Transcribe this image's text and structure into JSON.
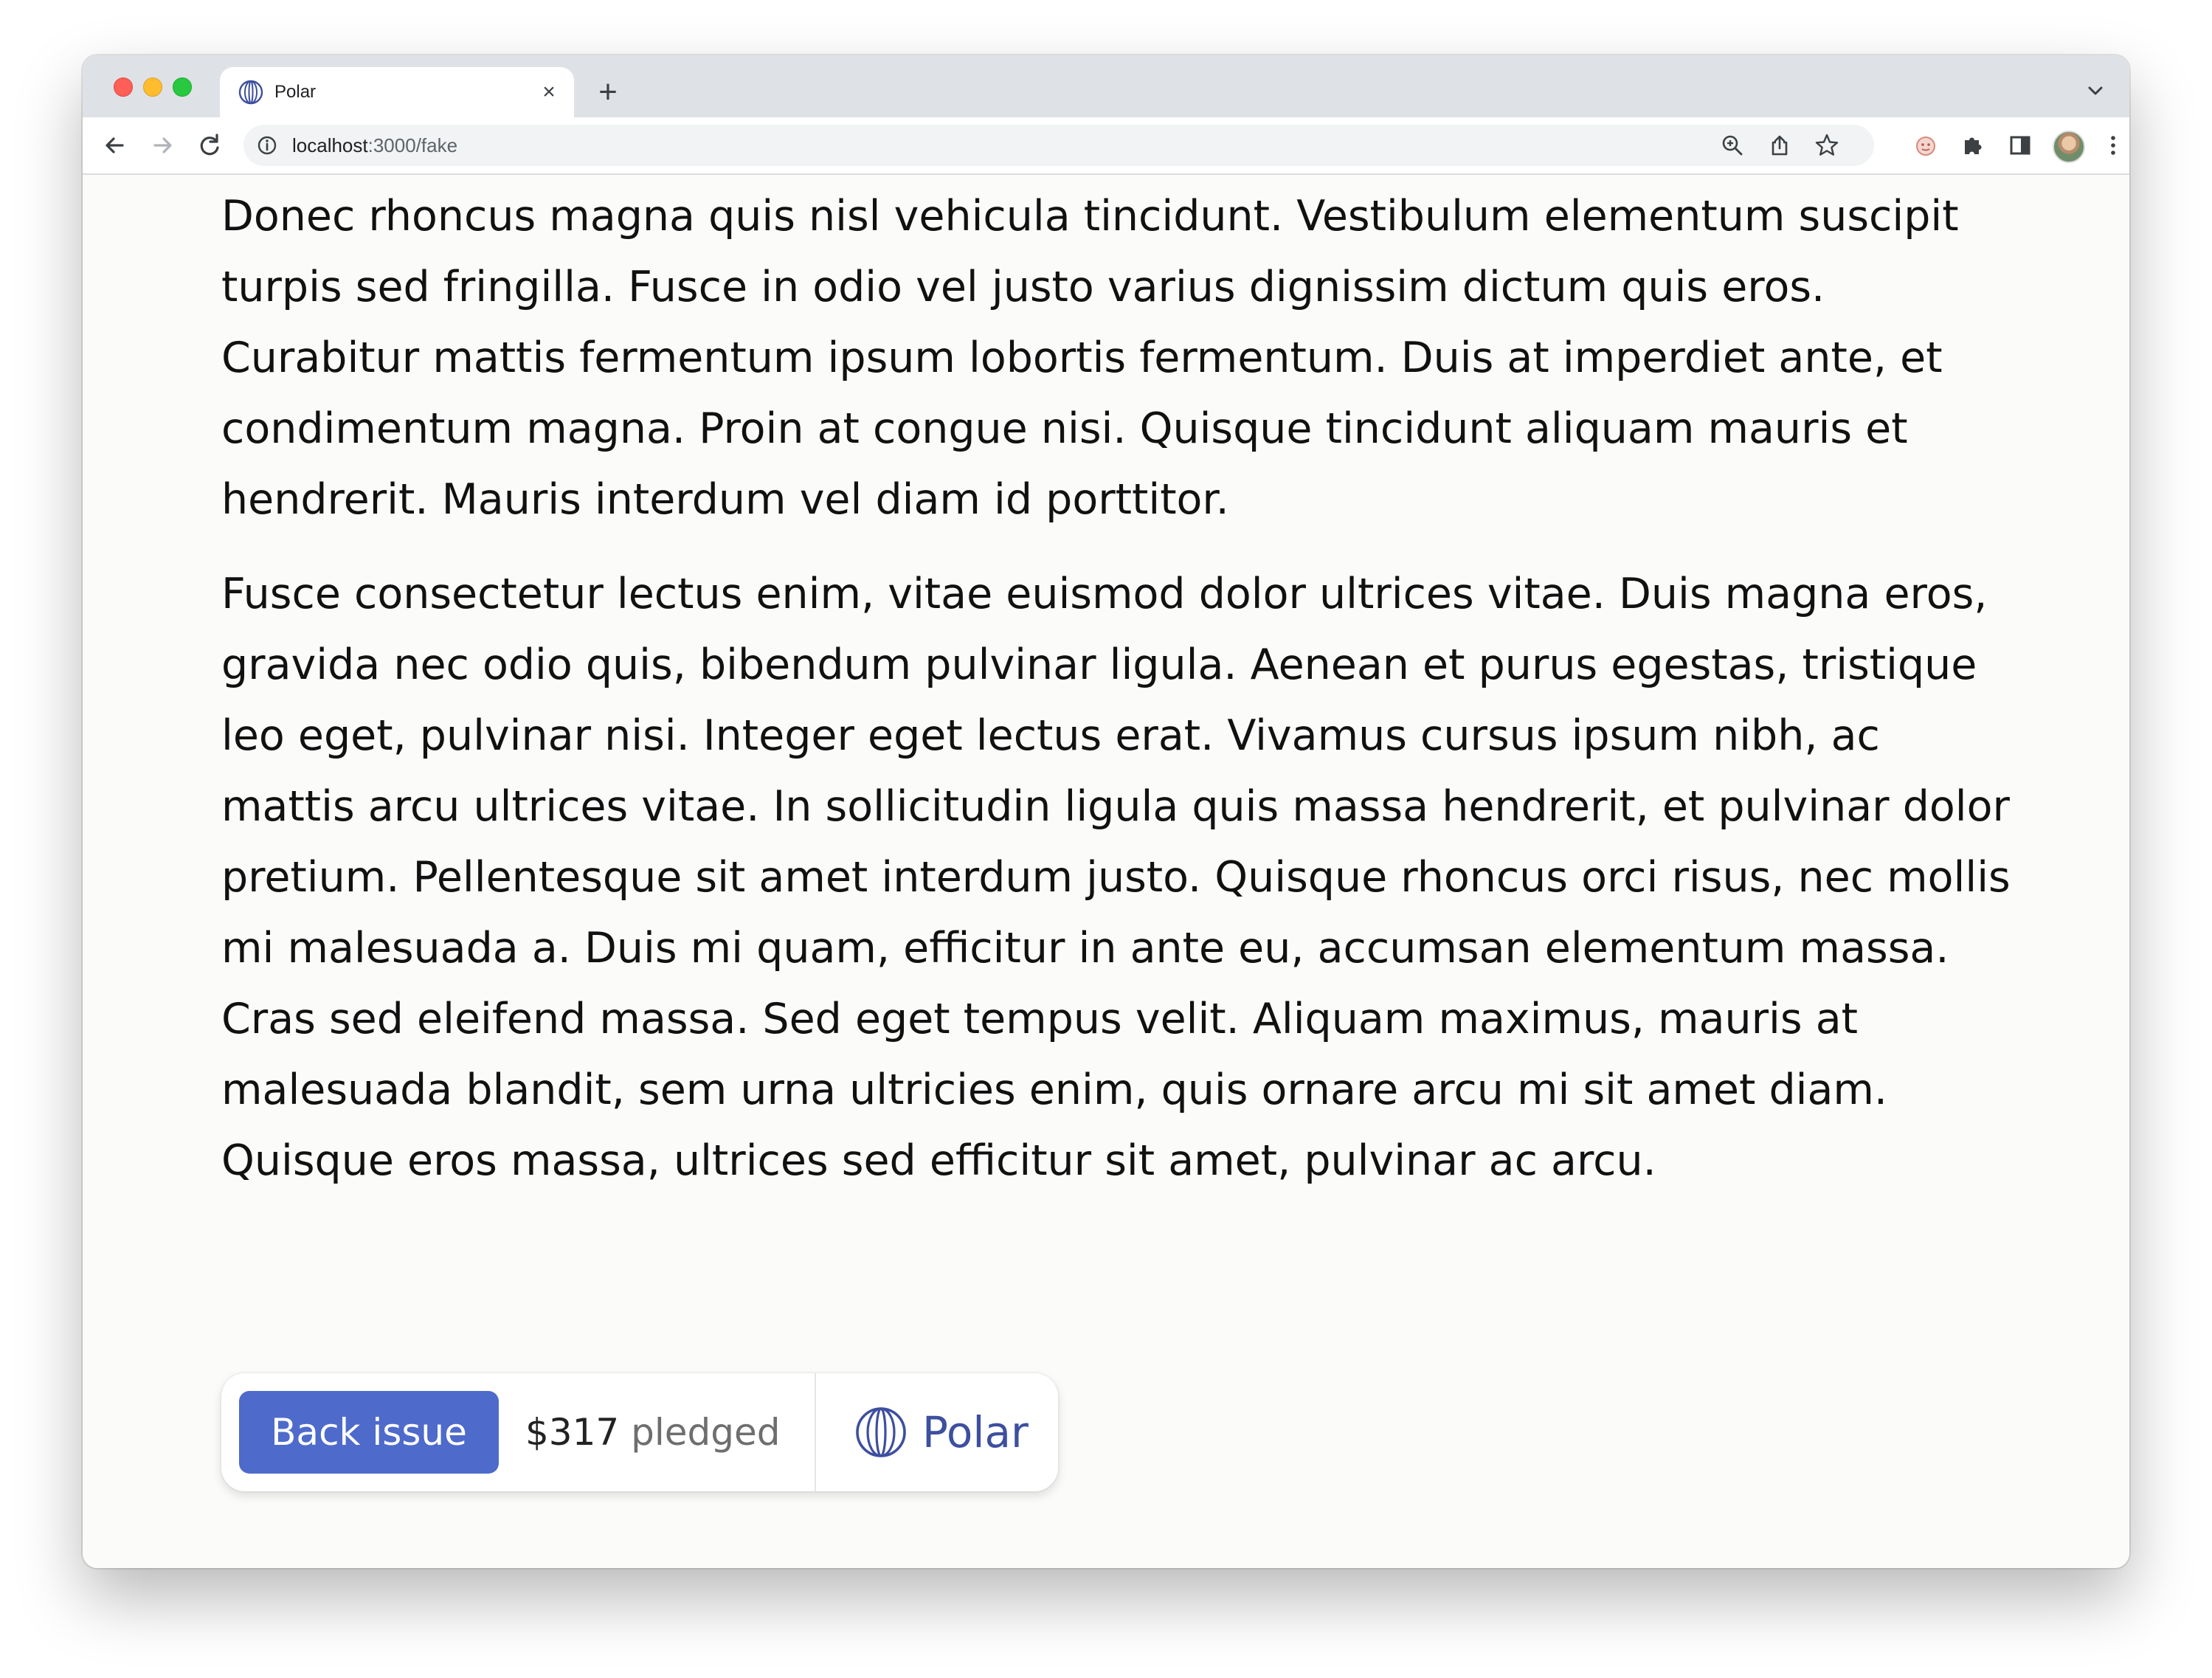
{
  "browser": {
    "tab": {
      "title": "Polar",
      "favicon": "polar-logo-icon",
      "close_glyph": "×"
    },
    "new_tab_glyph": "+",
    "url_host": "localhost",
    "url_path": ":3000/fake",
    "icons": {
      "back": "arrow-left-icon",
      "forward": "arrow-right-icon",
      "reload": "reload-icon",
      "site_info": "info-icon",
      "zoom": "zoom-icon",
      "share": "share-icon",
      "bookmark": "star-icon",
      "extension": "extension-icon",
      "puzzle": "puzzle-icon",
      "side_panel": "side-panel-icon",
      "menu": "kebab-menu-icon"
    }
  },
  "article": {
    "paragraphs": [
      "sit amet tempor non, sodales vel metus. Nullam volutpat dictum orci at maximus. Donec rhoncus magna quis nisl vehicula tincidunt. Vestibulum elementum suscipit turpis sed fringilla. Fusce in odio vel justo varius dignissim dictum quis eros. Curabitur mattis fermentum ipsum lobortis fermentum. Duis at imperdiet ante, et condimentum magna. Proin at congue nisi. Quisque tincidunt aliquam mauris et hendrerit. Mauris interdum vel diam id porttitor.",
      "Fusce consectetur lectus enim, vitae euismod dolor ultrices vitae. Duis magna eros, gravida nec odio quis, bibendum pulvinar ligula. Aenean et purus egestas, tristique leo eget, pulvinar nisi. Integer eget lectus erat. Vivamus cursus ipsum nibh, ac mattis arcu ultrices vitae. In sollicitudin ligula quis massa hendrerit, et pulvinar dolor pretium. Pellentesque sit amet interdum justo. Quisque rhoncus orci risus, nec mollis mi malesuada a. Duis mi quam, efficitur in ante eu, accumsan elementum massa. Cras sed eleifend massa. Sed eget tempus velit. Aliquam maximus, mauris at malesuada blandit, sem urna ultricies enim, quis ornare arcu mi sit amet diam. Quisque eros massa, ultrices sed efficitur sit amet, pulvinar ac arcu."
    ]
  },
  "badge": {
    "button_label": "Back issue",
    "pledged_amount": "$317",
    "pledged_label": "pledged",
    "brand_name": "Polar",
    "colors": {
      "button": "#4e6acb",
      "brand": "#3d4f9e"
    }
  }
}
